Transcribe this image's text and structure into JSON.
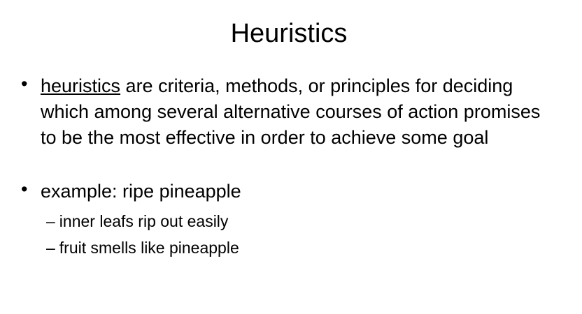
{
  "slide": {
    "title": "Heuristics",
    "bullets": [
      {
        "marker": "•",
        "term": "heuristics",
        "text": " are criteria, methods, or principles for deciding which among several alternative courses of action promises to be the most effective in order to achieve some goal"
      },
      {
        "marker": "•",
        "text": "example: ripe pineapple",
        "subitems": [
          {
            "marker": "–",
            "text": "inner leafs rip out easily"
          },
          {
            "marker": "–",
            "text": "fruit smells like pineapple"
          }
        ]
      }
    ]
  }
}
